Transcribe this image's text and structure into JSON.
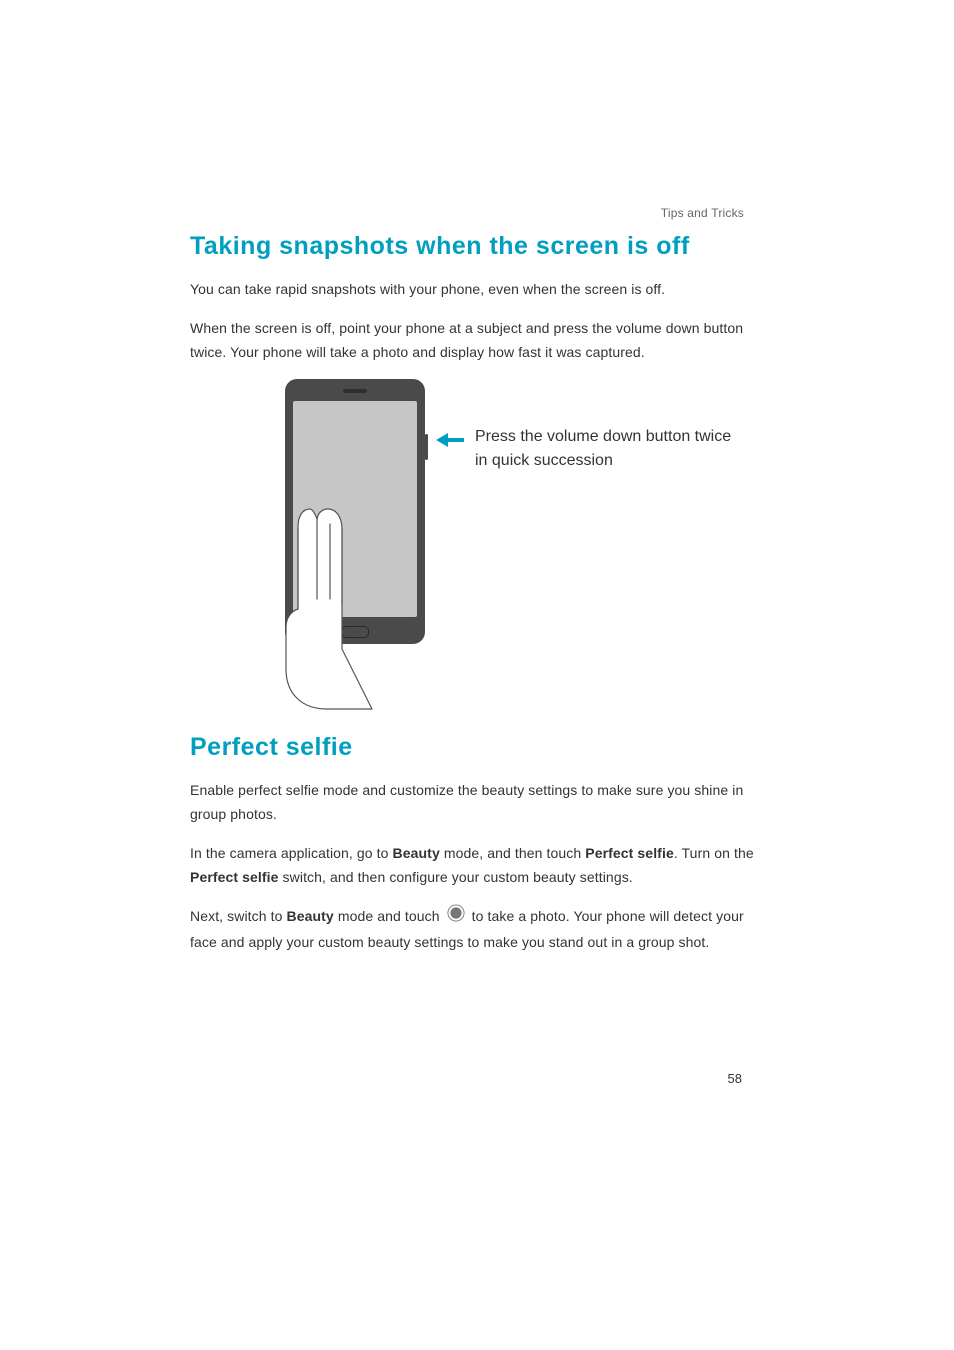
{
  "header": {
    "section_label": "Tips and Tricks"
  },
  "section1": {
    "heading": "Taking snapshots when the screen is off",
    "p1": "You can take rapid snapshots with your phone, even when the screen is off.",
    "p2": "When the screen is off, point your phone at a subject and press the volume down button twice. Your phone will take a photo and display how fast it was captured.",
    "callout": "Press the volume down button twice in quick succession"
  },
  "section2": {
    "heading": "Perfect selfie",
    "p1": "Enable perfect selfie mode and customize the beauty settings to make sure you shine in group photos.",
    "p2_pre": "In the camera application, go to ",
    "p2_b1": "Beauty",
    "p2_mid1": " mode, and then touch ",
    "p2_b2": "Perfect selfie",
    "p2_mid2": ". Turn on the ",
    "p2_b3": "Perfect selfie",
    "p2_post": " switch, and then configure your custom beauty settings.",
    "p3_pre": "Next, switch to ",
    "p3_b1": "Beauty",
    "p3_mid": " mode and touch ",
    "p3_post": " to take a photo. Your phone will detect your face and apply your custom beauty settings to make you stand out in a group shot."
  },
  "footer": {
    "page_number": "58"
  }
}
